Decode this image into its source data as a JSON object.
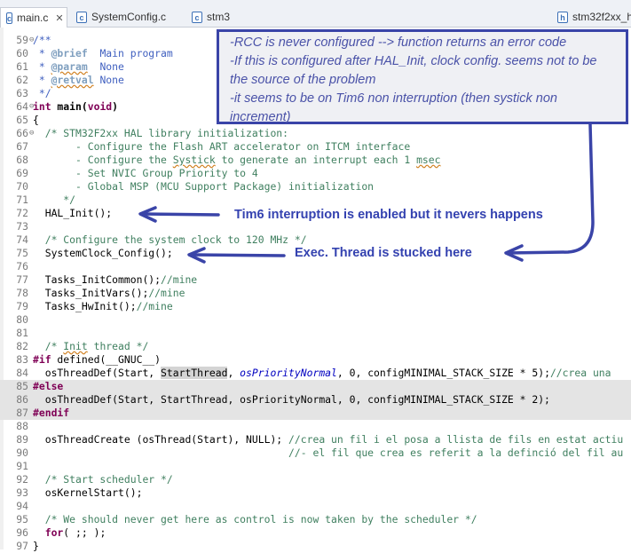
{
  "tabs": [
    {
      "label": "main.c",
      "active": true,
      "closable": true
    },
    {
      "label": "SystemConfig.c",
      "active": false
    },
    {
      "label": "stm3",
      "active": false
    },
    {
      "label": "stm32f2xx_h",
      "active": false
    }
  ],
  "note": {
    "lines": [
      "-RCC is never configured --> function returns an error code",
      "-If this is configured after HAL_Init, clock config. seems not to be",
      "the source of the problem",
      "-it seems to be on Tim6 non interruption (then systick non",
      "increment)"
    ]
  },
  "annotations": {
    "hal_init": "Tim6 interruption is enabled but it nevers happens",
    "sysclock": "Exec. Thread is stucked here"
  },
  "colors": {
    "annotation": "#3442b0",
    "box_border": "#3a44a8"
  },
  "code": {
    "l59": "/**",
    "l60a": " * ",
    "l60b": "@brief",
    "l60c": "  Main program",
    "l61a": " * ",
    "l61b": "@param",
    "l61c": "  None",
    "l62a": " * ",
    "l62b": "@retval",
    "l62c": " None",
    "l63": " */",
    "l64a": "int",
    "l64b": " main(",
    "l64c": "void",
    "l64d": ")",
    "l65": "{",
    "l66": "  /* STM32F2xx HAL library initialization:",
    "l67a": "       - Configure the Flash ART accelerator on ITCM interface",
    "l68a": "       - Configure the ",
    "l68b": "Systick",
    "l68c": " to generate an interrupt each 1 ",
    "l68d": "msec",
    "l69": "       - Set NVIC Group Priority to 4",
    "l70": "       - Global MSP (MCU Support Package) initialization",
    "l71": "     */",
    "l72": "  HAL_Init();",
    "l74": "  /* Configure the system clock to 120 MHz */",
    "l75": "  SystemClock_Config();",
    "l77a": "  Tasks_InitCommon();",
    "l77b": "//mine",
    "l78a": "  Tasks_InitVars();",
    "l78b": "//mine",
    "l79a": "  Tasks_HwInit();",
    "l79b": "//mine",
    "l82a": "  /* ",
    "l82b": "Init",
    "l82c": " thread */",
    "l83a": "#if",
    "l83b": " defined(__GNUC__)",
    "l84a": "  osThreadDef(Start, ",
    "l84b": "StartThread",
    "l84c": ", ",
    "l84d": "osPriorityNormal",
    "l84e": ", 0, configMINIMAL_STACK_SIZE * 5);",
    "l84f": "//crea una ",
    "l85": "#else",
    "l86": "  osThreadDef(Start, StartThread, osPriorityNormal, 0, configMINIMAL_STACK_SIZE * 2);",
    "l87": "#endif",
    "l89a": "  osThreadCreate (osThread(Start), NULL); ",
    "l89b": "//crea un fil i el posa a llista de fils en estat actiu",
    "l90": "                                          //- el fil que crea es referit a la definció del fil au",
    "l92": "  /* Start scheduler */",
    "l93": "  osKernelStart();",
    "l95": "  /* We should never get here as control is now taken by the scheduler */",
    "l96a": "  for",
    "l96b": "( ;; );",
    "l97": "}"
  }
}
